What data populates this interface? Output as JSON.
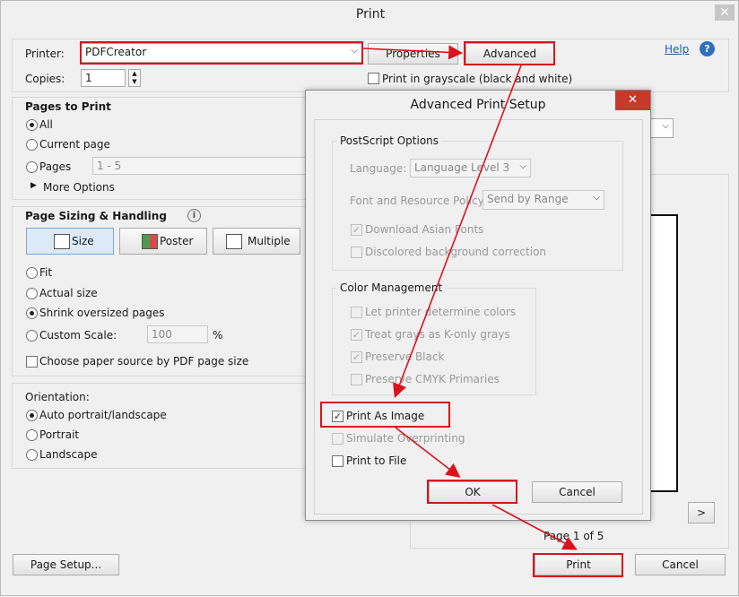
{
  "window": {
    "title": "Print",
    "close_glyph": "✕"
  },
  "printer": {
    "label": "Printer:",
    "value": "PDFCreator",
    "properties_label": "Properties",
    "advanced_label": "Advanced",
    "help_label": "Help",
    "help_icon": "?"
  },
  "copies": {
    "label": "Copies:",
    "value": "1",
    "grayscale_label": "Print in grayscale (black and white)"
  },
  "pages_to_print": {
    "heading": "Pages to Print",
    "all_label": "All",
    "current_label": "Current page",
    "pages_label": "Pages",
    "pages_value": "1 - 5",
    "more_label": "More Options",
    "selected": "All"
  },
  "sizing": {
    "heading": "Page Sizing & Handling",
    "info_icon": "i",
    "size_label": "Size",
    "poster_label": "Poster",
    "multiple_label": "Multiple",
    "fit_label": "Fit",
    "actual_label": "Actual size",
    "shrink_label": "Shrink oversized pages",
    "custom_label": "Custom Scale:",
    "custom_value": "100",
    "percent": "%",
    "paper_source_label": "Choose paper source by PDF page size",
    "selected": "Shrink oversized pages"
  },
  "orientation": {
    "heading": "Orientation:",
    "auto_label": "Auto portrait/landscape",
    "portrait_label": "Portrait",
    "landscape_label": "Landscape",
    "selected": "Auto portrait/landscape"
  },
  "preview": {
    "page_info": "Page 1 of 5",
    "next_label": ">"
  },
  "footer": {
    "page_setup_label": "Page Setup...",
    "print_label": "Print",
    "cancel_label": "Cancel"
  },
  "advanced_dialog": {
    "title": "Advanced Print Setup",
    "close_glyph": "✕",
    "postscript": {
      "heading": "PostScript Options",
      "language_label": "Language:",
      "language_value": "Language Level 3",
      "font_label": "Font and Resource Policy:",
      "font_value": "Send by Range",
      "download_asian_label": "Download Asian Fonts",
      "discolored_label": "Discolored background correction"
    },
    "color": {
      "heading": "Color Management",
      "let_printer_label": "Let printer determine colors",
      "treat_grays_label": "Treat grays as K-only grays",
      "preserve_black_label": "Preserve Black",
      "preserve_cmyk_label": "Preserve CMYK Primaries"
    },
    "print_as_image_label": "Print As Image",
    "simulate_overprinting_label": "Simulate Overprinting",
    "print_to_file_label": "Print to File",
    "ok_label": "OK",
    "cancel_label": "Cancel"
  },
  "colors": {
    "annotation_red": "#d9141b",
    "link_blue": "#1a5fb4"
  }
}
